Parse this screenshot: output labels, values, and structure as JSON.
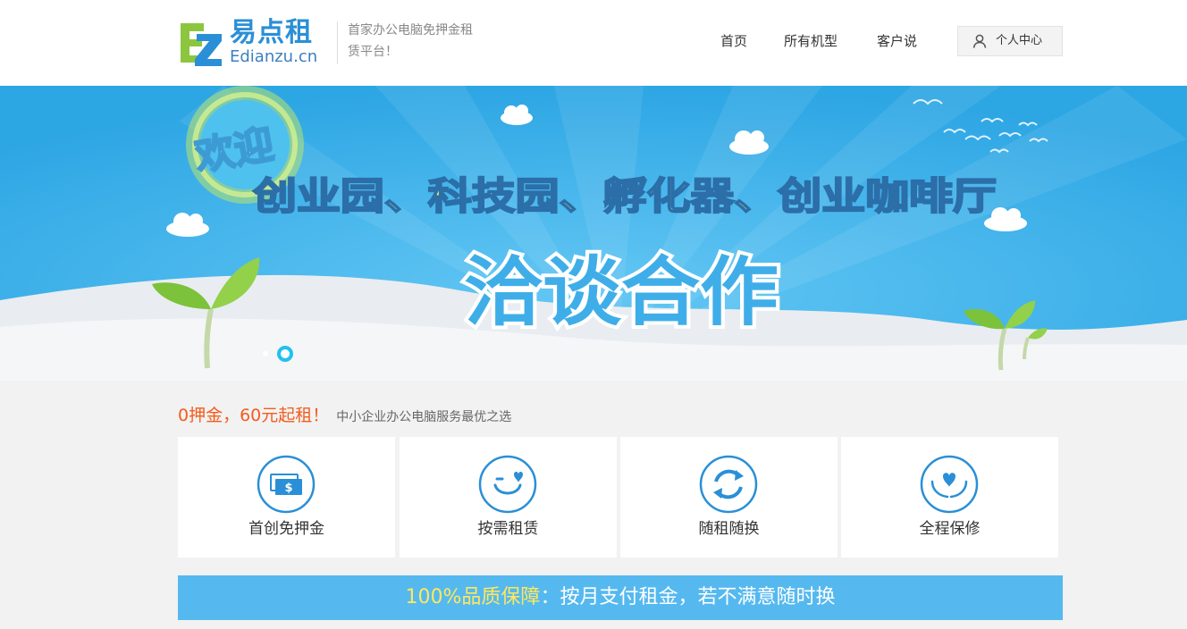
{
  "header": {
    "logo_cn": "易点租",
    "logo_en": "Edianzu.cn",
    "slogan_line1": "首家办公电脑免押金租",
    "slogan_line2": "赁平台！"
  },
  "nav": {
    "items": [
      {
        "label": "首页"
      },
      {
        "label": "所有机型"
      },
      {
        "label": "客户说"
      }
    ],
    "user_center": "个人中心"
  },
  "banner": {
    "welcome": "欢迎",
    "headline": "创业园、科技园、孵化器、创业咖啡厅",
    "big_text": "洽谈合作",
    "slides_total": 2,
    "active_slide": 2
  },
  "promo": {
    "main": "0押金，60元起租！",
    "sub": "中小企业办公电脑服务最优之选"
  },
  "features": [
    {
      "label": "首创免押金",
      "icon": "money-icon"
    },
    {
      "label": "按需租赁",
      "icon": "smile-heart-icon"
    },
    {
      "label": "随租随换",
      "icon": "refresh-icon"
    },
    {
      "label": "全程保修",
      "icon": "hands-heart-icon"
    }
  ],
  "quality": {
    "highlight": "100%品质保障",
    "text": "：按月支付租金，若不满意随时换"
  },
  "colors": {
    "accent_blue": "#2a8fd6",
    "banner_blue": "#37aee9",
    "promo_orange": "#f45c1d",
    "quality_bar": "#55b9ef",
    "quality_highlight": "#ffe85c"
  }
}
